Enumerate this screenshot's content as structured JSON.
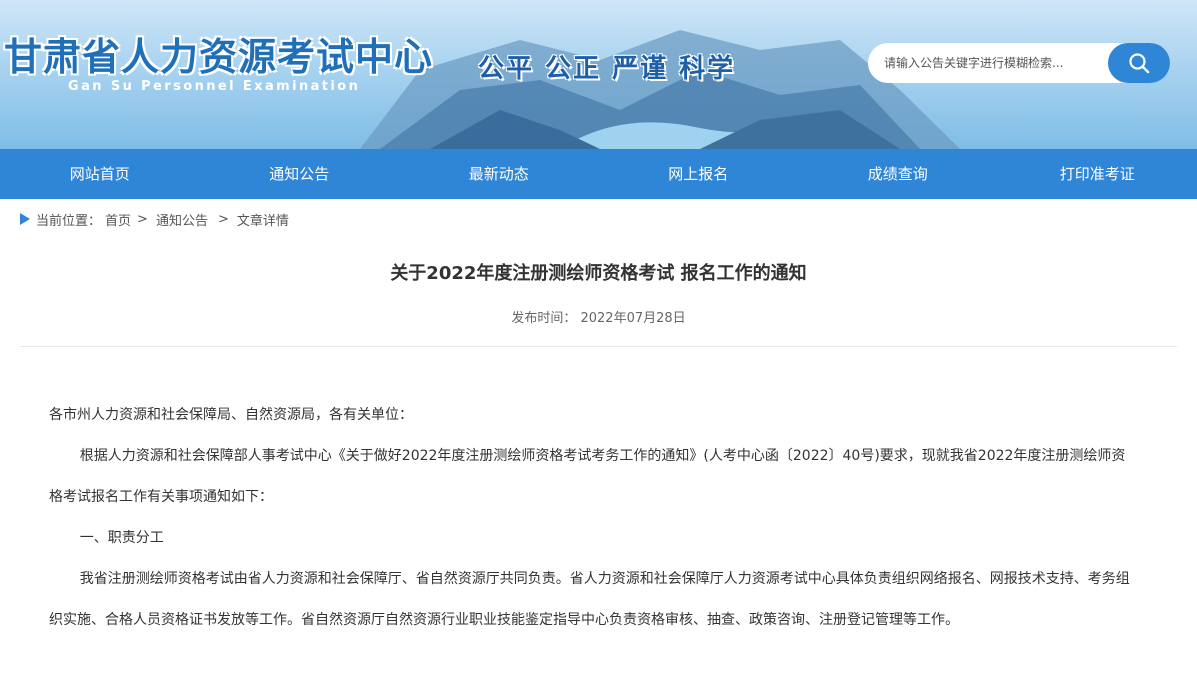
{
  "header": {
    "title": "甘肃省人力资源考试中心",
    "subtitle": "Gan Su Personnel Examination",
    "slogan": "公平 公正 严谨 科学",
    "search": {
      "placeholder": "请输入公告关键字进行模糊检索..."
    }
  },
  "nav": {
    "items": [
      {
        "label": "网站首页"
      },
      {
        "label": "通知公告"
      },
      {
        "label": "最新动态"
      },
      {
        "label": "网上报名"
      },
      {
        "label": "成绩查询"
      },
      {
        "label": "打印准考证"
      }
    ]
  },
  "breadcrumb": {
    "prefix": "当前位置：",
    "items": [
      "首页",
      "通知公告",
      "文章详情"
    ],
    "separator": ">"
  },
  "article": {
    "title": "关于2022年度注册测绘师资格考试 报名工作的通知",
    "date_label": "发布时间：",
    "date": "2022年07月28日",
    "paragraphs": [
      "各市州人力资源和社会保障局、自然资源局，各有关单位：",
      "根据人力资源和社会保障部人事考试中心《关于做好2022年度注册测绘师资格考试考务工作的通知》(人考中心函〔2022〕40号)要求，现就我省2022年度注册测绘师资格考试报名工作有关事项通知如下：",
      "一、职责分工",
      "我省注册测绘师资格考试由省人力资源和社会保障厅、省自然资源厅共同负责。省人力资源和社会保障厅人力资源考试中心具体负责组织网络报名、网报技术支持、考务组织实施、合格人员资格证书发放等工作。省自然资源厅自然资源行业职业技能鉴定指导中心负责资格审核、抽查、政策咨询、注册登记管理等工作。"
    ]
  },
  "colors": {
    "accent": "#2f86d6",
    "title_blue": "#1f6fb9"
  }
}
